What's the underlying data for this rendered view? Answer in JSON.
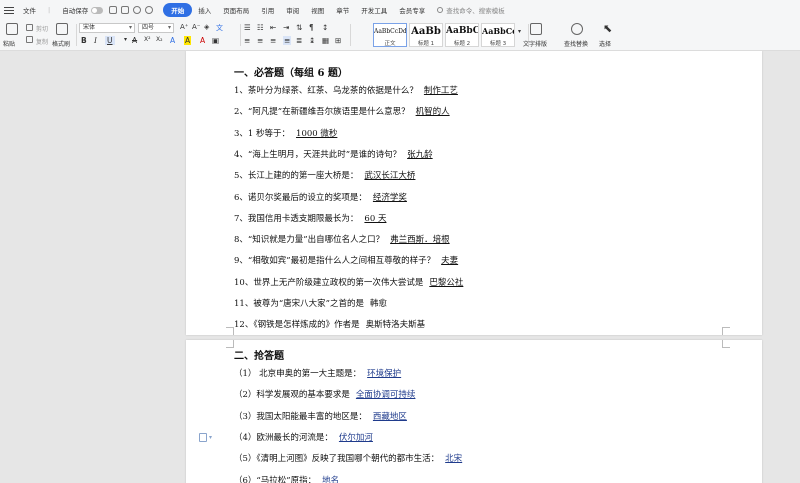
{
  "menu": {
    "file": "文件",
    "autosave": "自动保存",
    "tabs": [
      "开始",
      "插入",
      "页面布局",
      "引用",
      "审阅",
      "视图",
      "章节",
      "开发工具",
      "会员专享"
    ],
    "search": "查找命令、搜索模板"
  },
  "ribbon": {
    "paste": "粘贴",
    "cut": "剪切",
    "copy": "复制",
    "format_painter": "格式刷",
    "font_name": "宋体",
    "font_size": "四号",
    "styles": [
      {
        "preview": "AaBbCcDd",
        "name": "正文"
      },
      {
        "preview": "AaBb",
        "name": "标题 1"
      },
      {
        "preview": "AaBbC",
        "name": "标题 2"
      },
      {
        "preview": "AaBbCc",
        "name": "标题 3"
      }
    ],
    "text_layout": "文字排版",
    "find_replace": "查找替换",
    "select": "选择"
  },
  "doc": {
    "section1": "一、必答题（每组 6 题）",
    "q1": [
      {
        "q": "1、茶叶分为绿茶、红茶、乌龙茶的依据是什么？",
        "a": "制作工艺",
        "blue": false
      },
      {
        "q": "2、“阿凡提”在新疆维吾尔族语里是什么意思？",
        "a": "机智的人",
        "blue": false
      },
      {
        "q": "3、1 秒等于：",
        "a": "1000 微秒",
        "blue": false
      },
      {
        "q": "4、“海上生明月，天涯共此时”是谁的诗句？",
        "a": "张九龄",
        "blue": false
      },
      {
        "q": "5、长江上建的的第一座大桥是：",
        "a": "武汉长江大桥",
        "blue": false
      },
      {
        "q": "6、诺贝尔奖最后的设立的奖项是：",
        "a": "经济学奖",
        "blue": false
      },
      {
        "q": "7、我国信用卡透支期限最长为：",
        "a": "60 天",
        "blue": false
      },
      {
        "q": "8、“知识就是力量”出自哪位名人之口？",
        "a": "弗兰西斯．培根",
        "blue": false
      },
      {
        "q": "9、“相敬如宾”最初是指什么人之间相互尊敬的样子？",
        "a": "夫妻",
        "blue": false
      },
      {
        "q": "10、世界上无产阶级建立政权的第一次伟大尝试是",
        "a": "巴黎公社",
        "blue": false
      },
      {
        "q": "11、被尊为“唐宋八大家”之首的是",
        "a": "韩愈",
        "blue": false,
        "plain": true
      },
      {
        "q": "12、《钢铁是怎样炼成的》作者是",
        "a": "奥斯特洛夫斯基",
        "blue": false,
        "plain": true
      }
    ],
    "section2": "二、抢答题",
    "q2": [
      {
        "q": "（1）  北京申奥的第一大主题是：",
        "a": "环境保护",
        "blue": true
      },
      {
        "q": "（2）科学发展观的基本要求是",
        "a": "全面协调可持续",
        "blue": true
      },
      {
        "q": "（3）我国太阳能最丰富的地区是：",
        "a": "西藏地区",
        "blue": true
      },
      {
        "q": "（4）欧洲最长的河流是：",
        "a": "伏尔加河",
        "blue": true
      },
      {
        "q": "（5）《清明上河图》反映了我国哪个朝代的都市生活：",
        "a": "北宋",
        "blue": true
      },
      {
        "q": "（6）“马拉松”原指：",
        "a": "地名",
        "blue": true
      }
    ]
  }
}
